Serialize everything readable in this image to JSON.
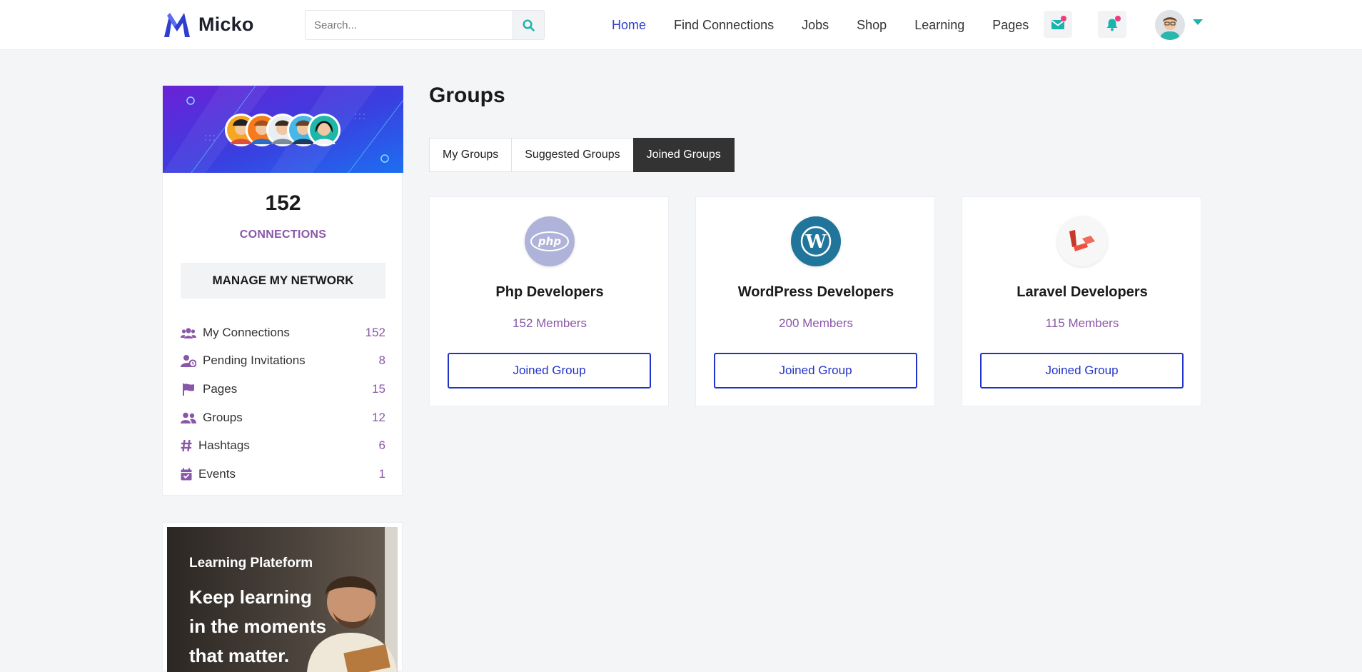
{
  "header": {
    "brand": "Micko",
    "search_placeholder": "Search...",
    "nav": [
      "Home",
      "Find Connections",
      "Jobs",
      "Shop",
      "Learning",
      "Pages"
    ],
    "active_nav": "Home",
    "accent_color": "#2f3ecf",
    "icon_color": "#1ab3ae",
    "notification_dot_color": "#ee3b7a"
  },
  "sidebar": {
    "connections_count": "152",
    "connections_label": "CONNECTIONS",
    "manage_button": "MANAGE MY NETWORK",
    "stats": [
      {
        "label": "My Connections",
        "count": "152",
        "icon": "users-icon"
      },
      {
        "label": "Pending Invitations",
        "count": "8",
        "icon": "user-clock-icon"
      },
      {
        "label": "Pages",
        "count": "15",
        "icon": "flag-icon"
      },
      {
        "label": "Groups",
        "count": "12",
        "icon": "user-group-icon"
      },
      {
        "label": "Hashtags",
        "count": "6",
        "icon": "hashtag-icon"
      },
      {
        "label": "Events",
        "count": "1",
        "icon": "calendar-check-icon"
      }
    ]
  },
  "ad": {
    "subtitle": "Learning Plateform",
    "title": "Keep learning in the moments that matter."
  },
  "main": {
    "title": "Groups",
    "tabs": [
      {
        "label": "My Groups",
        "active": false
      },
      {
        "label": "Suggested Groups",
        "active": false
      },
      {
        "label": "Joined Groups",
        "active": true
      }
    ],
    "groups": [
      {
        "name": "Php Developers",
        "members": "152 Members",
        "button": "Joined Group",
        "icon": "php-logo-icon"
      },
      {
        "name": "WordPress Developers",
        "members": "200 Members",
        "button": "Joined Group",
        "icon": "wordpress-logo-icon"
      },
      {
        "name": "Laravel Developers",
        "members": "115 Members",
        "button": "Joined Group",
        "icon": "laravel-logo-icon"
      }
    ]
  }
}
